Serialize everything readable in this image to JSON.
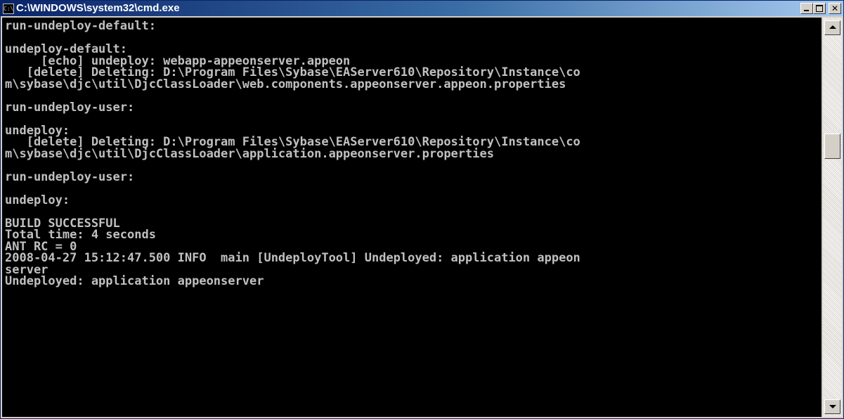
{
  "window": {
    "title": "C:\\WINDOWS\\system32\\cmd.exe",
    "icon": "cmd-icon",
    "icon_text": "C:\\",
    "buttons": {
      "minimize_icon": "minimize-icon",
      "maximize_icon": "maximize-icon",
      "close_icon": "close-icon",
      "close_glyph": "✕"
    }
  },
  "console": {
    "text": "run-undeploy-default:\n\nundeploy-default:\n     [echo] undeploy: webapp-appeonserver.appeon\n   [delete] Deleting: D:\\Program Files\\Sybase\\EAServer610\\Repository\\Instance\\co\nm\\sybase\\djc\\util\\DjcClassLoader\\web.components.appeonserver.appeon.properties\n\nrun-undeploy-user:\n\nundeploy:\n   [delete] Deleting: D:\\Program Files\\Sybase\\EAServer610\\Repository\\Instance\\co\nm\\sybase\\djc\\util\\DjcClassLoader\\application.appeonserver.properties\n\nrun-undeploy-user:\n\nundeploy:\n\nBUILD SUCCESSFUL\nTotal time: 4 seconds\nANT RC = 0\n2008-04-27 15:12:47.500 INFO  main [UndeployTool] Undeployed: application appeon\nserver\nUndeployed: application appeonserver",
    "colors": {
      "background": "#000000",
      "foreground": "#c0c0c0"
    }
  },
  "scrollbar": {
    "up_icon": "scroll-up-arrow-icon",
    "down_icon": "scroll-down-arrow-icon",
    "position": 0.3
  },
  "colors": {
    "title_start": "#0a246a",
    "title_end": "#a6caf0",
    "chrome": "#d4d0c8"
  }
}
